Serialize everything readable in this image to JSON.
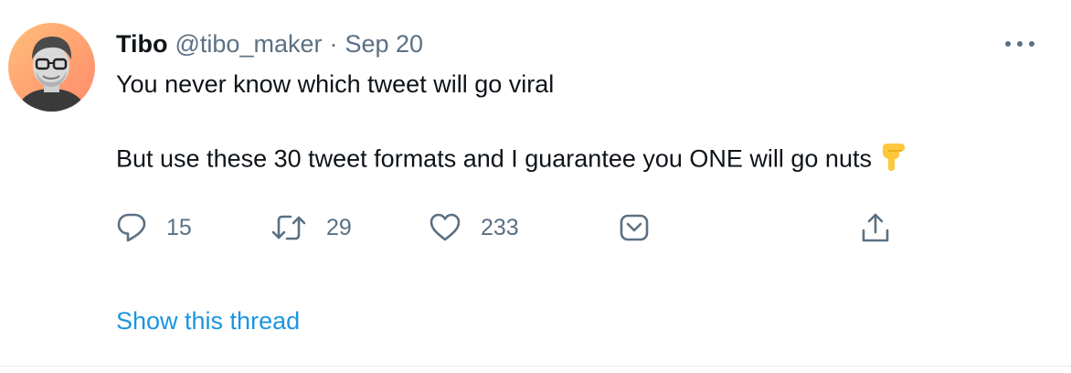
{
  "tweet": {
    "author_name": "Tibo",
    "handle": "@tibo_maker",
    "separator": "·",
    "date": "Sep 20",
    "line1": "You never know which tweet will go viral",
    "line2": "But use these 30 tweet formats and I guarantee you ONE will go nuts",
    "emoji": "backhand-index-pointing-down",
    "actions": {
      "reply_count": "15",
      "retweet_count": "29",
      "like_count": "233"
    },
    "show_thread": "Show this thread"
  },
  "colors": {
    "text": "#0f1419",
    "muted": "#5b7083",
    "link": "#1b95e0",
    "emoji": "#ffc83d"
  },
  "icons": [
    "avatar",
    "more-icon",
    "reply-icon",
    "retweet-icon",
    "like-icon",
    "save-icon",
    "share-icon",
    "pointing-down-emoji"
  ]
}
